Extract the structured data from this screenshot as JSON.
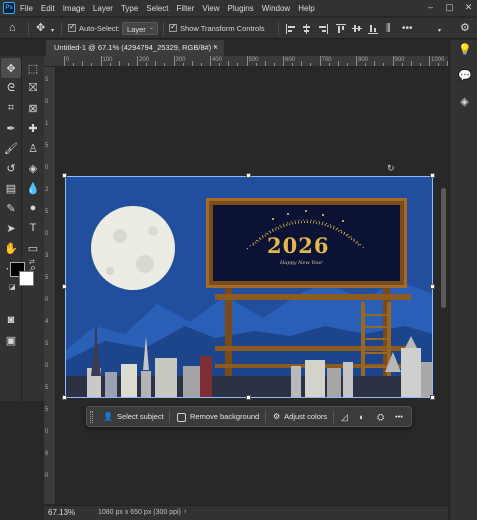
{
  "menubar": {
    "app_badge": "Ps",
    "items": [
      "File",
      "Edit",
      "Image",
      "Layer",
      "Type",
      "Select",
      "Filter",
      "View",
      "Plugins",
      "Window",
      "Help"
    ]
  },
  "options": {
    "auto_select_label": "Auto-Select:",
    "auto_select_value": "Layer",
    "show_transform_label": "Show Transform Controls"
  },
  "document": {
    "tab_title": "Untitled-1 @ 67.1% (4294794_25329, RGB/8#) *",
    "close_glyph": "×"
  },
  "ruler": {
    "labels": [
      "0",
      "100",
      "200",
      "300",
      "400",
      "500",
      "600",
      "700",
      "800",
      "900",
      "1000"
    ]
  },
  "vruler": {
    "labels": [
      "5",
      "0",
      "1",
      "5",
      "0",
      "2",
      "5",
      "0",
      "3",
      "5",
      "0",
      "4",
      "5",
      "0",
      "5",
      "5",
      "0",
      "6",
      "0"
    ]
  },
  "artwork": {
    "year": "2026",
    "greeting": "Happy New Year"
  },
  "taskbar": {
    "select_subject": "Select subject",
    "remove_background": "Remove background",
    "adjust_colors": "Adjust colors",
    "more": "•••"
  },
  "status": {
    "zoom": "67.13%",
    "doc_info": "1080 px x 650 px (300 ppi)",
    "caret": "›"
  },
  "colors": {
    "canvas_bg": "#214f9e",
    "accent": "#31a8ff",
    "gold": "#e2b74e"
  }
}
